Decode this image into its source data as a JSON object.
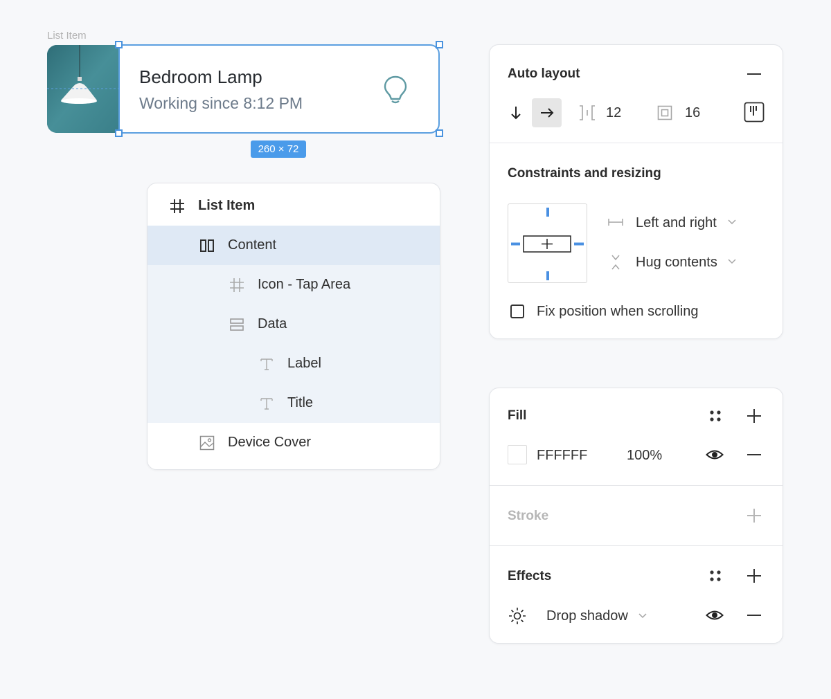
{
  "canvas": {
    "frame_label": "List Item",
    "card": {
      "title": "Bedroom Lamp",
      "subtitle": "Working since 8:12 PM"
    },
    "size_badge": "260 × 72"
  },
  "layers": {
    "items": [
      {
        "label": "List Item",
        "icon": "frame-hash-icon"
      },
      {
        "label": "Content",
        "icon": "columns-layout-icon"
      },
      {
        "label": "Icon - Tap Area",
        "icon": "frame-hash-icon"
      },
      {
        "label": "Data",
        "icon": "rows-layout-icon"
      },
      {
        "label": "Label",
        "icon": "text-icon"
      },
      {
        "label": "Title",
        "icon": "text-icon"
      },
      {
        "label": "Device Cover",
        "icon": "image-icon"
      }
    ]
  },
  "auto_layout": {
    "title": "Auto layout",
    "spacing": "12",
    "padding": "16"
  },
  "constraints": {
    "title": "Constraints and resizing",
    "horizontal": "Left and right",
    "vertical": "Hug contents",
    "fix_position": "Fix position when scrolling"
  },
  "fill": {
    "title": "Fill",
    "color": "FFFFFF",
    "opacity": "100%"
  },
  "stroke": {
    "title": "Stroke"
  },
  "effects": {
    "title": "Effects",
    "effect": "Drop shadow"
  },
  "colors": {
    "selection": "#4a9bea",
    "lamp_bg": "#3d7f88"
  }
}
